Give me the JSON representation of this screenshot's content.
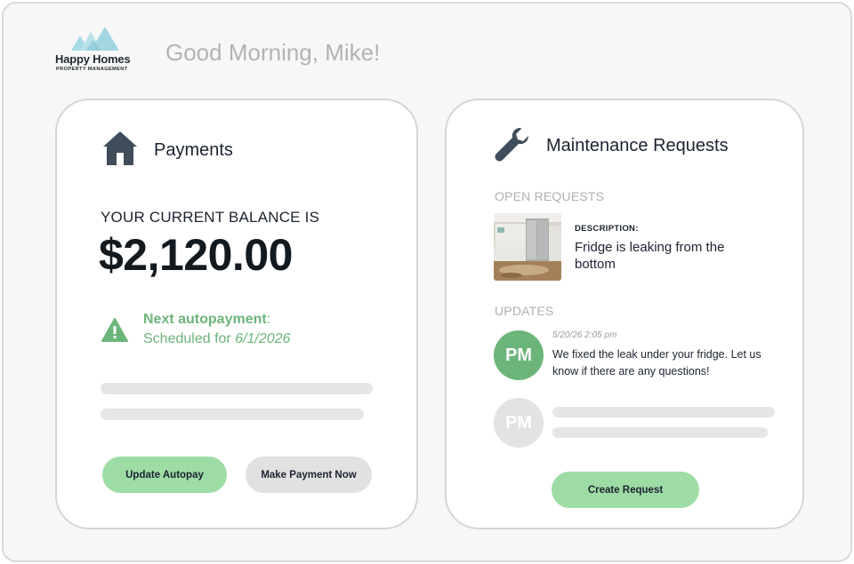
{
  "brand": {
    "name": "Happy Homes",
    "subtitle": "PROPERTY MANAGEMENT",
    "colors": {
      "light": "#a9dbe6",
      "mid": "#86c9d8"
    }
  },
  "greeting": "Good Morning, Mike!",
  "payments": {
    "title": "Payments",
    "icon": "house-icon",
    "balance_label": "YOUR CURRENT BALANCE IS",
    "balance": "$2,120.00",
    "autopay": {
      "icon": "warning-icon",
      "label": "Next autopayment",
      "colon": ":",
      "scheduled_prefix": "Scheduled for ",
      "date": "6/1/2026"
    },
    "buttons": {
      "update_autopay": "Update Autopay",
      "make_payment": "Make Payment Now"
    }
  },
  "maintenance": {
    "title": "Maintenance Requests",
    "icon": "wrench-icon",
    "open_requests_label": "OPEN REQUESTS",
    "request": {
      "description_label": "DESCRIPTION:",
      "description": "Fridge is leaking from the bottom"
    },
    "updates_label": "UPDATES",
    "updates": [
      {
        "initials": "PM",
        "timestamp": "5/20/26  2:05 pm",
        "message": "We fixed the leak under your fridge. Let us know if there are any questions!"
      },
      {
        "initials": "PM"
      }
    ],
    "create_button": "Create Request"
  },
  "colors": {
    "accent_green": "#6cb57a",
    "button_green": "#9edca5",
    "button_grey": "#e1e1e1",
    "icon_dark": "#3f4d5a"
  }
}
